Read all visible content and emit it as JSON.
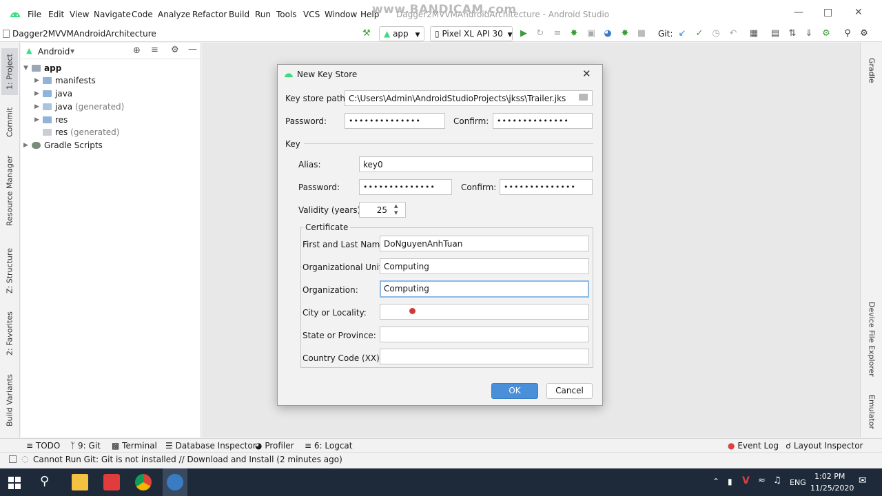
{
  "menu": {
    "items": [
      "File",
      "Edit",
      "View",
      "Navigate",
      "Code",
      "Analyze",
      "Refactor",
      "Build",
      "Run",
      "Tools",
      "VCS",
      "Window",
      "Help"
    ],
    "window_title": "Dagger2MVVMAndroidArchitecture - Android Studio",
    "watermark": "www.BANDICAM.com"
  },
  "toolbar": {
    "project_name": "Dagger2MVVMAndroidArchitecture",
    "run_config": "app",
    "device": "Pixel XL API 30",
    "git_label": "Git:"
  },
  "left_tabs": [
    "1: Project",
    "Commit",
    "Resource Manager",
    "Z: Structure",
    "2: Favorites",
    "Build Variants"
  ],
  "right_tabs": [
    "Gradle",
    "Device File Explorer",
    "Emulator"
  ],
  "project_panel": {
    "view_mode": "Android",
    "tree": [
      {
        "label": "app",
        "extra": ""
      },
      {
        "label": "manifests",
        "extra": ""
      },
      {
        "label": "java",
        "extra": ""
      },
      {
        "label": "java",
        "extra": "(generated)"
      },
      {
        "label": "res",
        "extra": ""
      },
      {
        "label": "res",
        "extra": "(generated)"
      },
      {
        "label": "Gradle Scripts",
        "extra": ""
      }
    ]
  },
  "dialog": {
    "title": "New Key Store",
    "key_store_path_label": "Key store path:",
    "key_store_path": "C:\\Users\\Admin\\AndroidStudioProjects\\jkss\\Trailer.jks",
    "password_label": "Password:",
    "password_mask": "••••••••••••••",
    "confirm_label": "Confirm:",
    "confirm_mask": "••••••••••••••",
    "key_section": "Key",
    "alias_label": "Alias:",
    "alias": "key0",
    "key_password_label": "Password:",
    "key_password_mask": "••••••••••••••",
    "key_confirm_label": "Confirm:",
    "key_confirm_mask": "••••••••••••••",
    "validity_label": "Validity (years):",
    "validity": "25",
    "certificate": {
      "title": "Certificate",
      "first_last_label": "First and Last Name:",
      "first_last": "DoNguyenAnhTuan",
      "org_unit_label": "Organizational Unit:",
      "org_unit": "Computing",
      "organization_label": "Organization:",
      "organization": "Computing",
      "city_label": "City or Locality:",
      "city": "",
      "state_label": "State or Province:",
      "state": "",
      "country_label": "Country Code (XX):",
      "country": ""
    },
    "ok_label": "OK",
    "cancel_label": "Cancel"
  },
  "bottom_tabs": {
    "todo": "TODO",
    "git": "9: Git",
    "terminal": "Terminal",
    "database": "Database Inspector",
    "profiler": "Profiler",
    "logcat": "6: Logcat",
    "event_log": "Event Log",
    "layout_inspector": "Layout Inspector"
  },
  "status": {
    "message": "Cannot Run Git: Git is not installed // Download and Install (2 minutes ago)"
  },
  "taskbar": {
    "language": "ENG",
    "time": "1:02 PM",
    "date": "11/25/2020"
  },
  "colors": {
    "accent": "#4a8fd9",
    "android_green": "#3ddc84",
    "taskbar": "#1e2a3a"
  }
}
